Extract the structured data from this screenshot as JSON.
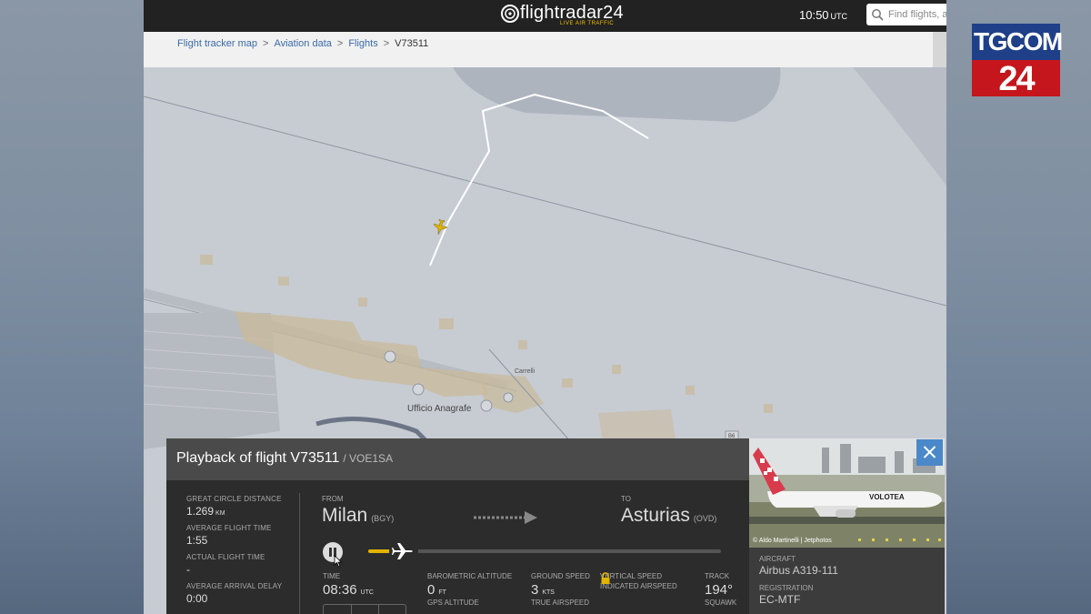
{
  "header": {
    "logo_text": "flightradar24",
    "logo_tagline": "LIVE AIR TRAFFIC",
    "time": "10:50",
    "time_zone": "UTC",
    "search_placeholder": "Find flights, a"
  },
  "breadcrumbs": {
    "items": [
      "Flight tracker map",
      "Aviation data",
      "Flights"
    ],
    "current": "V73511"
  },
  "map": {
    "labels": {
      "carrelli": "Carrelli",
      "office": "Ufficio Anagrafe",
      "road_marker": "B6"
    },
    "route_color": "#ffffff",
    "aircraft_color": "#e1b400"
  },
  "playback": {
    "title": "Playback of flight V73511",
    "callsign": "/ VOE1SA",
    "stats": [
      {
        "label": "GREAT CIRCLE DISTANCE",
        "value": "1.269",
        "unit": "KM"
      },
      {
        "label": "AVERAGE FLIGHT TIME",
        "value": "1:55",
        "unit": ""
      },
      {
        "label": "ACTUAL FLIGHT TIME",
        "value": "-",
        "unit": ""
      },
      {
        "label": "AVERAGE ARRIVAL DELAY",
        "value": "0:00",
        "unit": ""
      }
    ],
    "from_label": "FROM",
    "from_city": "Milan",
    "from_code": "(BGY)",
    "to_label": "TO",
    "to_city": "Asturias",
    "to_code": "(OVD)",
    "progress": 0.1,
    "time_label": "TIME",
    "time_value": "08:36",
    "time_unit": "UTC",
    "baro_label": "BAROMETRIC ALTITUDE",
    "baro_value": "0",
    "baro_unit": "FT",
    "gps_label": "GPS ALTITUDE",
    "gs_label": "GROUND SPEED",
    "gs_value": "3",
    "gs_unit": "KTS",
    "tas_label": "TRUE AIRSPEED",
    "vs_label": "VERTICAL SPEED",
    "ias_label": "INDICATED AIRSPEED",
    "track_label": "TRACK",
    "track_value": "194°",
    "squawk_label": "SQUAWK"
  },
  "aircraft": {
    "photo_credit": "© Aldo Martinelli | Jetphotos",
    "livery_text": "VOLOTEA",
    "aircraft_label": "AIRCRAFT",
    "aircraft_value": "Airbus A319-111",
    "registration_label": "REGISTRATION",
    "registration_value": "EC-MTF"
  },
  "broadcaster": {
    "line1": "TGCOM",
    "line2": "24"
  }
}
